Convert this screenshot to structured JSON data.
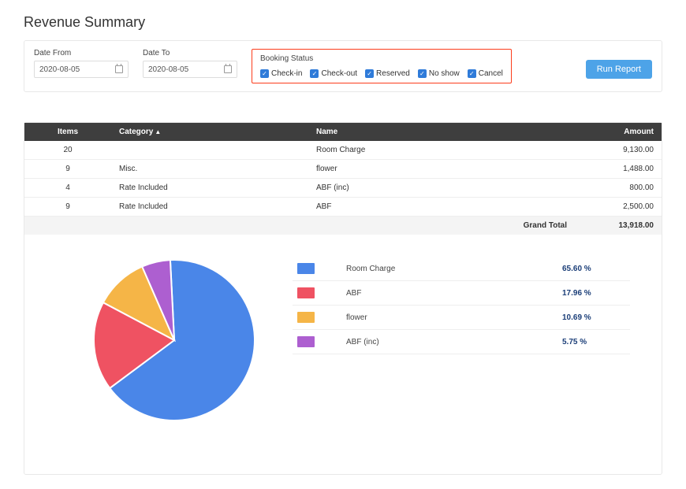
{
  "title": "Revenue Summary",
  "filters": {
    "date_from": {
      "label": "Date From",
      "value": "2020-08-05"
    },
    "date_to": {
      "label": "Date To",
      "value": "2020-08-05"
    },
    "booking_status": {
      "label": "Booking Status",
      "options": [
        {
          "label": "Check-in",
          "checked": true
        },
        {
          "label": "Check-out",
          "checked": true
        },
        {
          "label": "Reserved",
          "checked": true
        },
        {
          "label": "No show",
          "checked": true
        },
        {
          "label": "Cancel",
          "checked": true
        }
      ]
    },
    "run_button": "Run Report"
  },
  "table": {
    "headers": {
      "items": "Items",
      "category": "Category",
      "name": "Name",
      "amount": "Amount"
    },
    "rows": [
      {
        "items": "20",
        "category": "",
        "name": "Room Charge",
        "amount": "9,130.00"
      },
      {
        "items": "9",
        "category": "Misc.",
        "name": "flower",
        "amount": "1,488.00"
      },
      {
        "items": "4",
        "category": "Rate Included",
        "name": "ABF (inc)",
        "amount": "800.00"
      },
      {
        "items": "9",
        "category": "Rate Included",
        "name": "ABF",
        "amount": "2,500.00"
      }
    ],
    "grand_total": {
      "label": "Grand Total",
      "amount": "13,918.00"
    }
  },
  "chart_data": {
    "type": "pie",
    "series": [
      {
        "name": "Room Charge",
        "percent": 65.6,
        "color": "#4a86e8"
      },
      {
        "name": "ABF",
        "percent": 17.96,
        "color": "#ef5262"
      },
      {
        "name": "flower",
        "percent": 10.69,
        "color": "#f5b547"
      },
      {
        "name": "ABF (inc)",
        "percent": 5.75,
        "color": "#ad5fd0"
      }
    ],
    "legend": [
      {
        "name": "Room Charge",
        "percent_label": "65.60 %",
        "color": "#4a86e8"
      },
      {
        "name": "ABF",
        "percent_label": "17.96 %",
        "color": "#ef5262"
      },
      {
        "name": "flower",
        "percent_label": "10.69 %",
        "color": "#f5b547"
      },
      {
        "name": "ABF (inc)",
        "percent_label": "5.75 %",
        "color": "#ad5fd0"
      }
    ]
  }
}
